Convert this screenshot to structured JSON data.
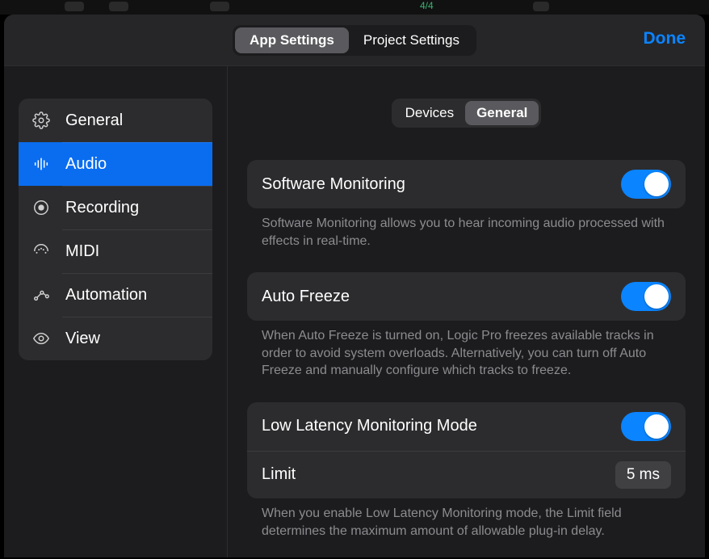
{
  "backdrop": {
    "fraction": "4/4"
  },
  "header": {
    "tab_app": "App Settings",
    "tab_project": "Project Settings",
    "done": "Done"
  },
  "sidebar": {
    "items": [
      {
        "label": "General"
      },
      {
        "label": "Audio"
      },
      {
        "label": "Recording"
      },
      {
        "label": "MIDI"
      },
      {
        "label": "Automation"
      },
      {
        "label": "View"
      }
    ]
  },
  "subtabs": {
    "devices": "Devices",
    "general": "General"
  },
  "settings": {
    "software_monitoring": {
      "title": "Software Monitoring",
      "desc": "Software Monitoring allows you to hear incoming audio processed with effects in real-time."
    },
    "auto_freeze": {
      "title": "Auto Freeze",
      "desc": "When Auto Freeze is turned on, Logic Pro freezes available tracks in order to avoid system overloads. Alternatively, you can turn off Auto Freeze and manually configure which tracks to freeze."
    },
    "low_latency": {
      "title": "Low Latency Monitoring Mode",
      "limit_label": "Limit",
      "limit_value": "5 ms",
      "desc": "When you enable Low Latency Monitoring mode, the Limit field determines the maximum amount of allowable plug-in delay."
    }
  }
}
